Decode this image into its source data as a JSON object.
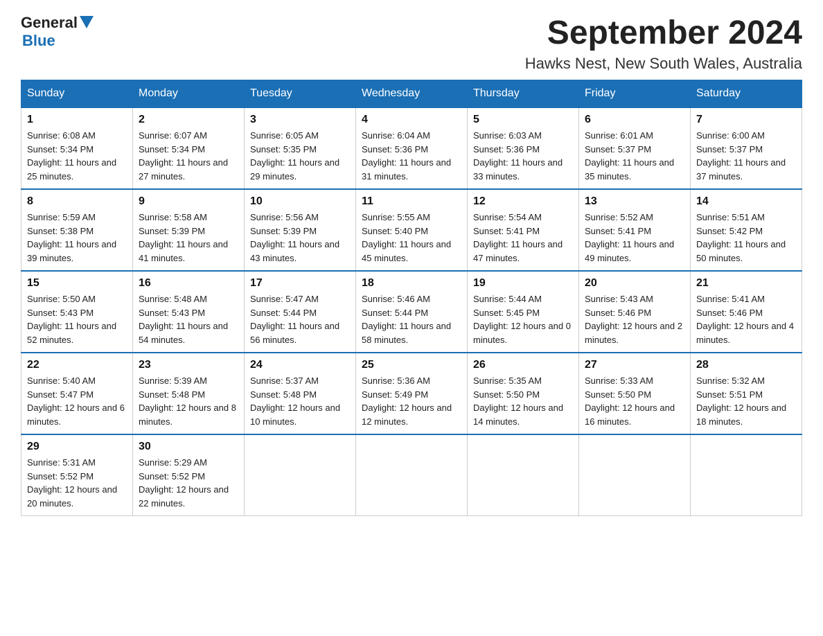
{
  "logo": {
    "general": "General",
    "blue": "Blue"
  },
  "header": {
    "title": "September 2024",
    "subtitle": "Hawks Nest, New South Wales, Australia"
  },
  "days_of_week": [
    "Sunday",
    "Monday",
    "Tuesday",
    "Wednesday",
    "Thursday",
    "Friday",
    "Saturday"
  ],
  "weeks": [
    [
      {
        "day": "1",
        "sunrise": "6:08 AM",
        "sunset": "5:34 PM",
        "daylight": "11 hours and 25 minutes."
      },
      {
        "day": "2",
        "sunrise": "6:07 AM",
        "sunset": "5:34 PM",
        "daylight": "11 hours and 27 minutes."
      },
      {
        "day": "3",
        "sunrise": "6:05 AM",
        "sunset": "5:35 PM",
        "daylight": "11 hours and 29 minutes."
      },
      {
        "day": "4",
        "sunrise": "6:04 AM",
        "sunset": "5:36 PM",
        "daylight": "11 hours and 31 minutes."
      },
      {
        "day": "5",
        "sunrise": "6:03 AM",
        "sunset": "5:36 PM",
        "daylight": "11 hours and 33 minutes."
      },
      {
        "day": "6",
        "sunrise": "6:01 AM",
        "sunset": "5:37 PM",
        "daylight": "11 hours and 35 minutes."
      },
      {
        "day": "7",
        "sunrise": "6:00 AM",
        "sunset": "5:37 PM",
        "daylight": "11 hours and 37 minutes."
      }
    ],
    [
      {
        "day": "8",
        "sunrise": "5:59 AM",
        "sunset": "5:38 PM",
        "daylight": "11 hours and 39 minutes."
      },
      {
        "day": "9",
        "sunrise": "5:58 AM",
        "sunset": "5:39 PM",
        "daylight": "11 hours and 41 minutes."
      },
      {
        "day": "10",
        "sunrise": "5:56 AM",
        "sunset": "5:39 PM",
        "daylight": "11 hours and 43 minutes."
      },
      {
        "day": "11",
        "sunrise": "5:55 AM",
        "sunset": "5:40 PM",
        "daylight": "11 hours and 45 minutes."
      },
      {
        "day": "12",
        "sunrise": "5:54 AM",
        "sunset": "5:41 PM",
        "daylight": "11 hours and 47 minutes."
      },
      {
        "day": "13",
        "sunrise": "5:52 AM",
        "sunset": "5:41 PM",
        "daylight": "11 hours and 49 minutes."
      },
      {
        "day": "14",
        "sunrise": "5:51 AM",
        "sunset": "5:42 PM",
        "daylight": "11 hours and 50 minutes."
      }
    ],
    [
      {
        "day": "15",
        "sunrise": "5:50 AM",
        "sunset": "5:43 PM",
        "daylight": "11 hours and 52 minutes."
      },
      {
        "day": "16",
        "sunrise": "5:48 AM",
        "sunset": "5:43 PM",
        "daylight": "11 hours and 54 minutes."
      },
      {
        "day": "17",
        "sunrise": "5:47 AM",
        "sunset": "5:44 PM",
        "daylight": "11 hours and 56 minutes."
      },
      {
        "day": "18",
        "sunrise": "5:46 AM",
        "sunset": "5:44 PM",
        "daylight": "11 hours and 58 minutes."
      },
      {
        "day": "19",
        "sunrise": "5:44 AM",
        "sunset": "5:45 PM",
        "daylight": "12 hours and 0 minutes."
      },
      {
        "day": "20",
        "sunrise": "5:43 AM",
        "sunset": "5:46 PM",
        "daylight": "12 hours and 2 minutes."
      },
      {
        "day": "21",
        "sunrise": "5:41 AM",
        "sunset": "5:46 PM",
        "daylight": "12 hours and 4 minutes."
      }
    ],
    [
      {
        "day": "22",
        "sunrise": "5:40 AM",
        "sunset": "5:47 PM",
        "daylight": "12 hours and 6 minutes."
      },
      {
        "day": "23",
        "sunrise": "5:39 AM",
        "sunset": "5:48 PM",
        "daylight": "12 hours and 8 minutes."
      },
      {
        "day": "24",
        "sunrise": "5:37 AM",
        "sunset": "5:48 PM",
        "daylight": "12 hours and 10 minutes."
      },
      {
        "day": "25",
        "sunrise": "5:36 AM",
        "sunset": "5:49 PM",
        "daylight": "12 hours and 12 minutes."
      },
      {
        "day": "26",
        "sunrise": "5:35 AM",
        "sunset": "5:50 PM",
        "daylight": "12 hours and 14 minutes."
      },
      {
        "day": "27",
        "sunrise": "5:33 AM",
        "sunset": "5:50 PM",
        "daylight": "12 hours and 16 minutes."
      },
      {
        "day": "28",
        "sunrise": "5:32 AM",
        "sunset": "5:51 PM",
        "daylight": "12 hours and 18 minutes."
      }
    ],
    [
      {
        "day": "29",
        "sunrise": "5:31 AM",
        "sunset": "5:52 PM",
        "daylight": "12 hours and 20 minutes."
      },
      {
        "day": "30",
        "sunrise": "5:29 AM",
        "sunset": "5:52 PM",
        "daylight": "12 hours and 22 minutes."
      },
      null,
      null,
      null,
      null,
      null
    ]
  ]
}
